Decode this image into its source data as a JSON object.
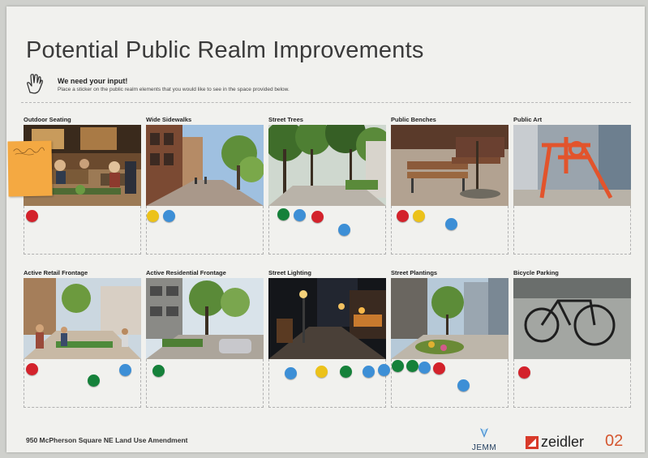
{
  "board": {
    "title": "Potential Public Realm Improvements",
    "input_heading": "We need your input!",
    "input_instructions": "Place a sticker on the public realm elements that you would like to see in the space provided below.",
    "footer_text": "950 McPherson Square NE Land Use Amendment",
    "logo_jemm": "JEMM",
    "logo_zeidler": "zeidler",
    "page_number": "02"
  },
  "colors": {
    "red": "#d3222b",
    "yellow": "#ecc21a",
    "blue": "#3d8fd6",
    "green": "#15813a",
    "postit": "#f4a942"
  },
  "icons": [
    "hand-pointer-icon",
    "jemm-logo-icon",
    "zeidler-logo-icon"
  ],
  "cards": [
    {
      "label": "Outdoor Seating",
      "stickers": [
        "red"
      ]
    },
    {
      "label": "Wide Sidewalks",
      "stickers": [
        "yellow",
        "blue"
      ]
    },
    {
      "label": "Street Trees",
      "stickers": [
        "green",
        "blue",
        "red",
        "blue"
      ]
    },
    {
      "label": "Public Benches",
      "stickers": [
        "red",
        "yellow",
        "blue"
      ]
    },
    {
      "label": "Public Art",
      "stickers": []
    },
    {
      "label": "Active Retail Frontage",
      "stickers": [
        "red",
        "green",
        "blue"
      ]
    },
    {
      "label": "Active Residential Frontage",
      "stickers": [
        "green"
      ]
    },
    {
      "label": "Street Lighting",
      "stickers": [
        "blue",
        "yellow",
        "green",
        "blue",
        "blue"
      ]
    },
    {
      "label": "Street Plantings",
      "stickers": [
        "green",
        "green",
        "blue",
        "red",
        "blue"
      ]
    },
    {
      "label": "Bicycle Parking",
      "stickers": [
        "red"
      ]
    }
  ]
}
